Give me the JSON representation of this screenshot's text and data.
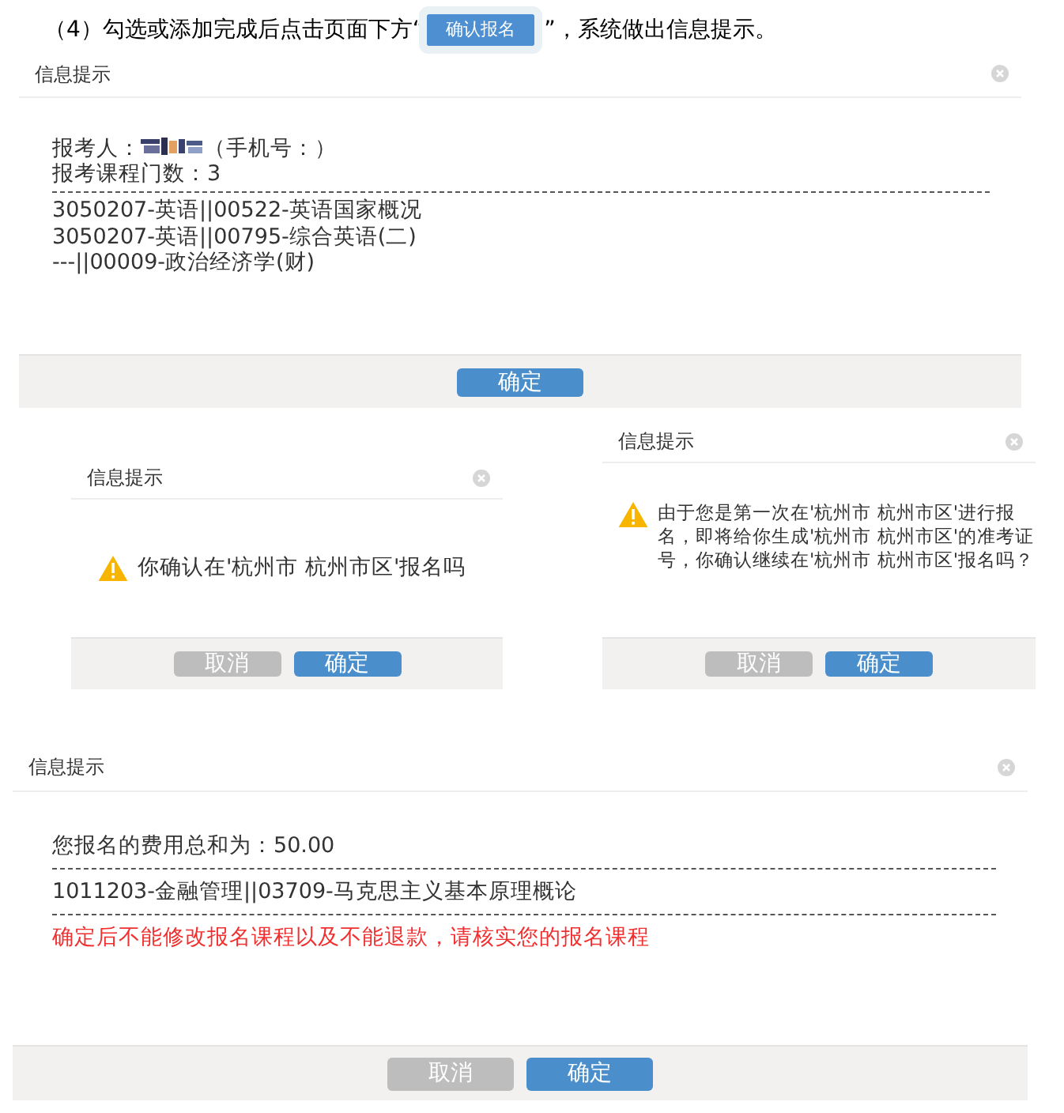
{
  "instruction": {
    "before": "（4）勾选或添加完成后点击页面下方“",
    "button": "确认报名",
    "after": "”，系统做出信息提示。"
  },
  "dialogs": [
    {
      "title": "信息提示",
      "body": [
        {
          "kind": "applicant",
          "label": "报考人：",
          "suffix": "（手机号：）"
        },
        {
          "kind": "line",
          "text": "报考课程门数：3"
        },
        {
          "kind": "divider"
        },
        {
          "kind": "line",
          "text": "3050207-英语||00522-英语国家概况"
        },
        {
          "kind": "line",
          "text": "3050207-英语||00795-综合英语(二)"
        },
        {
          "kind": "line",
          "text": "---||00009-政治经济学(财)"
        }
      ],
      "buttons": [
        {
          "label": "确定",
          "kind": "primary"
        }
      ]
    },
    {
      "title": "信息提示",
      "body": [
        {
          "kind": "warning",
          "lines": [
            "你确认在'杭州市 杭州市区'报名吗"
          ]
        }
      ],
      "buttons": [
        {
          "label": "取消",
          "kind": "secondary"
        },
        {
          "label": "确定",
          "kind": "primary"
        }
      ]
    },
    {
      "title": "信息提示",
      "body": [
        {
          "kind": "warning",
          "lines": [
            "由于您是第一次在'杭州市 杭州市区'进行报",
            "名，即将给你生成'杭州市 杭州市区'的准考证",
            "号，你确认继续在'杭州市 杭州市区'报名吗？"
          ]
        }
      ],
      "buttons": [
        {
          "label": "取消",
          "kind": "secondary"
        },
        {
          "label": "确定",
          "kind": "primary"
        }
      ]
    },
    {
      "title": "信息提示",
      "body": [
        {
          "kind": "line",
          "text": "您报名的费用总和为：50.00"
        },
        {
          "kind": "divider"
        },
        {
          "kind": "line",
          "text": "1011203-金融管理||03709-马克思主义基本原理概论"
        },
        {
          "kind": "divider"
        },
        {
          "kind": "alert",
          "text": "确定后不能修改报名课程以及不能退款，请核实您的报名课程"
        }
      ],
      "buttons": [
        {
          "label": "取消",
          "kind": "secondary"
        },
        {
          "label": "确定",
          "kind": "primary"
        }
      ]
    }
  ]
}
